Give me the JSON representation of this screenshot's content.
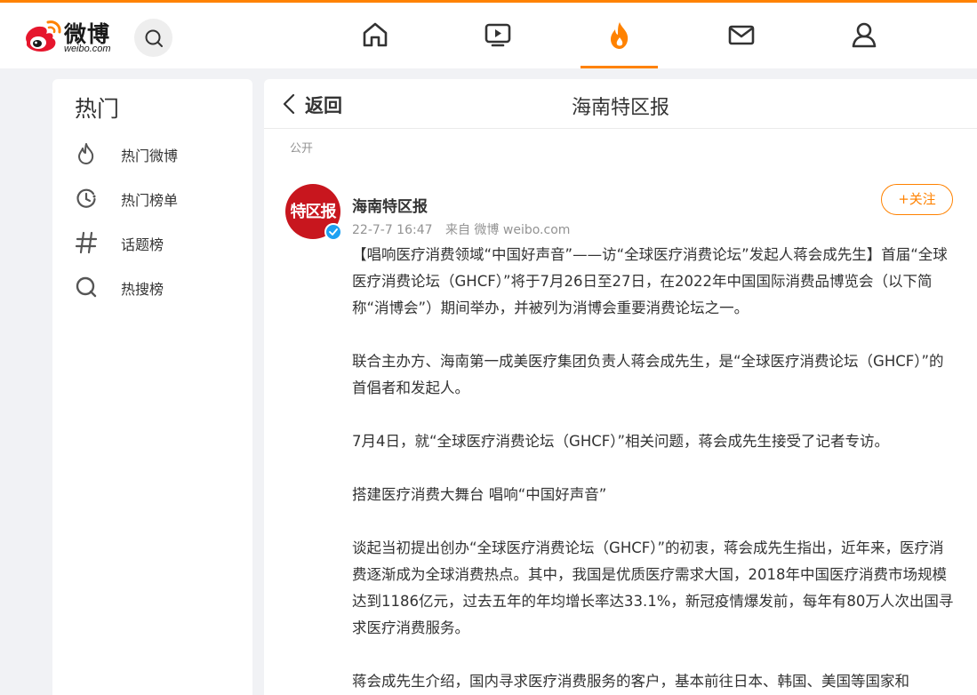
{
  "brand": {
    "name_cn": "微博",
    "name_en": "weibo.com",
    "accent_color": "#ff8200"
  },
  "nav": {
    "items": [
      {
        "icon": "home-icon",
        "active": false
      },
      {
        "icon": "video-icon",
        "active": false
      },
      {
        "icon": "hot-fire-icon",
        "active": true
      },
      {
        "icon": "message-icon",
        "active": false
      },
      {
        "icon": "profile-icon",
        "active": false
      }
    ]
  },
  "sidebar": {
    "title": "热门",
    "items": [
      {
        "label": "热门微博",
        "icon": "flame-icon"
      },
      {
        "label": "热门榜单",
        "icon": "clock-icon"
      },
      {
        "label": "话题榜",
        "icon": "hashtag-icon"
      },
      {
        "label": "热搜榜",
        "icon": "search-ring-icon"
      }
    ]
  },
  "main": {
    "back_label": "返回",
    "title": "海南特区报",
    "visibility": "公开"
  },
  "post": {
    "author": "海南特区报",
    "avatar_text": "特区报",
    "time": "22-7-7 16:47",
    "source": "来自 微博 weibo.com",
    "follow_label": "+关注",
    "paragraphs": [
      "【唱响医疗消费领域“中国好声音”——访“全球医疗消费论坛”发起人蒋会成先生】首届“全球医疗消费论坛（GHCF）”将于7月26日至27日，在2022年中国国际消费品博览会（以下简称“消博会”）期间举办，并被列为消博会重要消费论坛之一。",
      "联合主办方、海南第一成美医疗集团负责人蒋会成先生，是“全球医疗消费论坛（GHCF）”的首倡者和发起人。",
      "7月4日，就“全球医疗消费论坛（GHCF）”相关问题，蒋会成先生接受了记者专访。",
      "搭建医疗消费大舞台  唱响“中国好声音”",
      "谈起当初提出创办“全球医疗消费论坛（GHCF）”的初衷，蒋会成先生指出，近年来，医疗消费逐渐成为全球消费热点。其中，我国是优质医疗需求大国，2018年中国医疗消费市场规模达到1186亿元，过去五年的年均增长率达33.1%，新冠疫情爆发前，每年有80万人次出国寻求医疗消费服务。",
      "蒋会成先生介绍，国内寻求医疗消费服务的客户，基本前往日本、韩国、美国等国家和"
    ]
  }
}
